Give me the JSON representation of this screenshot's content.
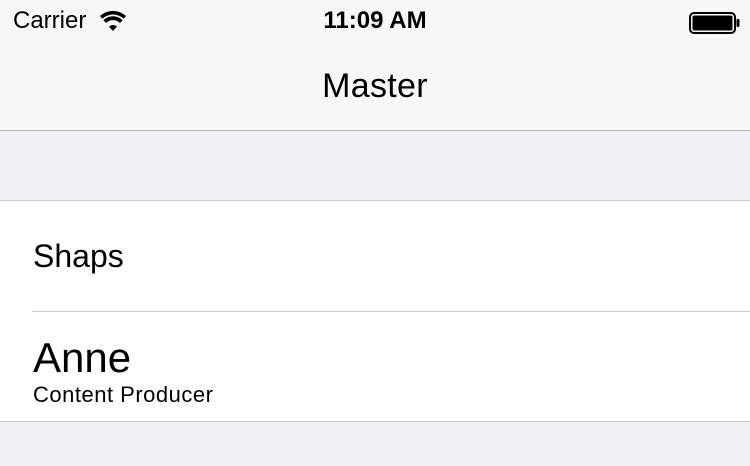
{
  "status_bar": {
    "carrier": "Carrier",
    "time": "11:09 AM",
    "wifi_icon": "wifi-icon",
    "battery_icon": "battery-icon"
  },
  "nav_bar": {
    "title": "Master"
  },
  "table": {
    "rows": [
      {
        "title": "Shaps"
      },
      {
        "title": "Anne",
        "subtitle": "Content Producer"
      }
    ]
  }
}
